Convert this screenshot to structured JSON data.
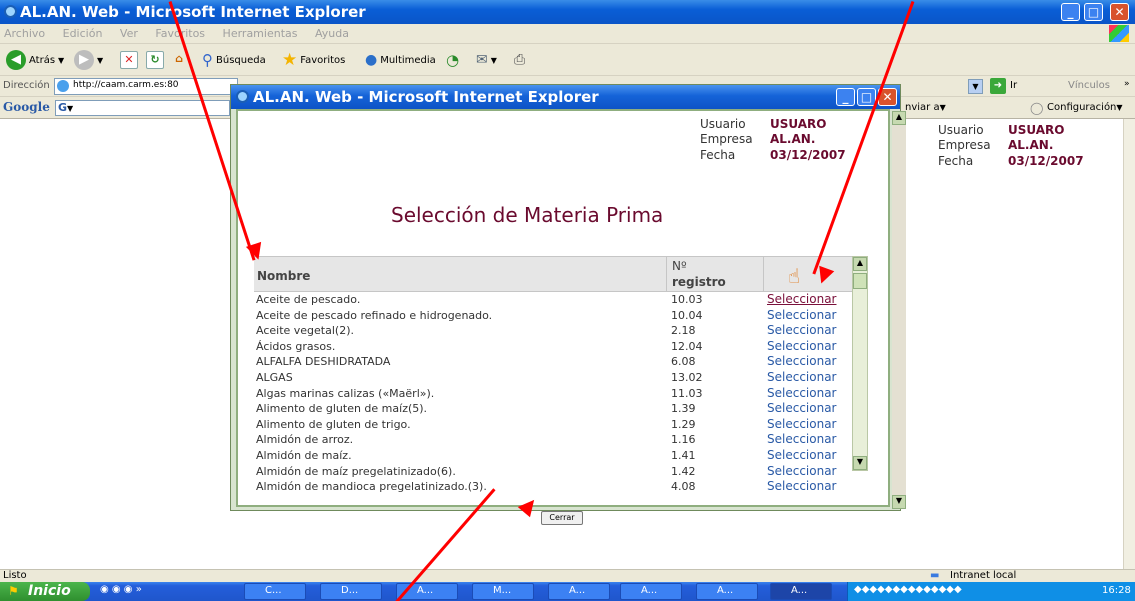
{
  "browser": {
    "title": "AL.AN. Web - Microsoft Internet Explorer",
    "menu": [
      "Archivo",
      "Edición",
      "Ver",
      "Favoritos",
      "Herramientas",
      "Ayuda"
    ],
    "toolbar": {
      "back": "Atrás",
      "search": "Búsqueda",
      "favorites": "Favoritos",
      "media": "Multimedia"
    },
    "address_label": "Dirección",
    "address_value": "http://caam.carm.es:80",
    "go_label": "Ir",
    "links_label": "Vínculos",
    "send_label": "nviar a",
    "google_label": "Google",
    "google_g": "G",
    "config_label": "Configuración",
    "status_text": "Listo",
    "zone_text": "Intranet local"
  },
  "page_header": {
    "usuario_label": "Usuario",
    "usuario_value": "USUARO",
    "empresa_label": "Empresa",
    "empresa_value": "AL.AN.",
    "fecha_label": "Fecha",
    "fecha_value": "03/12/2007"
  },
  "popup": {
    "title": "AL.AN. Web - Microsoft Internet Explorer",
    "usuario_label": "Usuario",
    "usuario_value": "USUARO",
    "empresa_label": "Empresa",
    "empresa_value": "AL.AN.",
    "fecha_label": "Fecha",
    "fecha_value": "03/12/2007",
    "heading": "Selección de Materia Prima",
    "col_nombre": "Nombre",
    "col_registro_1": "Nº",
    "col_registro_2": "registro",
    "rows": [
      {
        "nombre": "Aceite de pescado.",
        "registro": "10.03",
        "accion": "Seleccionar"
      },
      {
        "nombre": "Aceite de pescado refinado e hidrogenado.",
        "registro": "10.04",
        "accion": "Seleccionar"
      },
      {
        "nombre": "Aceite vegetal(2).",
        "registro": "2.18",
        "accion": "Seleccionar"
      },
      {
        "nombre": "Ácidos grasos.",
        "registro": "12.04",
        "accion": "Seleccionar"
      },
      {
        "nombre": "ALFALFA DESHIDRATADA",
        "registro": "6.08",
        "accion": "Seleccionar"
      },
      {
        "nombre": "ALGAS",
        "registro": "13.02",
        "accion": "Seleccionar"
      },
      {
        "nombre": "Algas marinas calizas («Maërl»).",
        "registro": "11.03",
        "accion": "Seleccionar"
      },
      {
        "nombre": "Alimento de gluten de maíz(5).",
        "registro": "1.39",
        "accion": "Seleccionar"
      },
      {
        "nombre": "Alimento de gluten de trigo.",
        "registro": "1.29",
        "accion": "Seleccionar"
      },
      {
        "nombre": "Almidón de arroz.",
        "registro": "1.16",
        "accion": "Seleccionar"
      },
      {
        "nombre": "Almidón de maíz.",
        "registro": "1.41",
        "accion": "Seleccionar"
      },
      {
        "nombre": "Almidón de maíz pregelatinizado(6).",
        "registro": "1.42",
        "accion": "Seleccionar"
      },
      {
        "nombre": "Almidón de mandioca pregelatinizado.(3).",
        "registro": "4.08",
        "accion": "Seleccionar"
      }
    ],
    "close_button": "Cerrar"
  },
  "taskbar": {
    "start": "Inicio",
    "buttons": [
      "C...",
      "D...",
      "A...",
      "M...",
      "A...",
      "A...",
      "A...",
      "A..."
    ],
    "clock": "16:28"
  }
}
